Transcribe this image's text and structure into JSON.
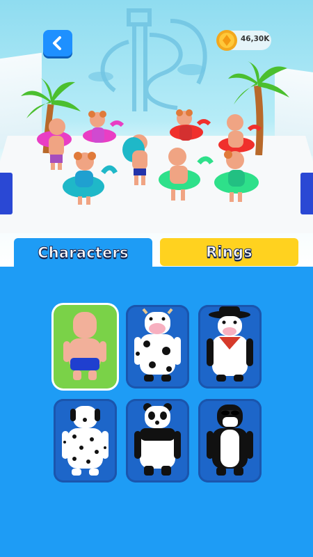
{
  "header": {
    "back_icon": "chevron-left-icon",
    "coins": "46,30K",
    "coin_icon": "coin-icon"
  },
  "tabs": [
    {
      "label": "Characters",
      "active": true,
      "color": "#1e9cf5"
    },
    {
      "label": "Rings",
      "active": false,
      "color": "#ffd21f"
    }
  ],
  "characters": [
    {
      "id": "boy-swimmer",
      "selected": true
    },
    {
      "id": "cow",
      "selected": false
    },
    {
      "id": "cowboy-cow",
      "selected": false
    },
    {
      "id": "dalmatian",
      "selected": false
    },
    {
      "id": "panda",
      "selected": false
    },
    {
      "id": "penguin-sunglasses",
      "selected": false
    }
  ],
  "colors": {
    "panel": "#1e9cf5",
    "card": "#1d66c9",
    "selected_card": "#7ad248",
    "rings_tab": "#ffd21f"
  }
}
